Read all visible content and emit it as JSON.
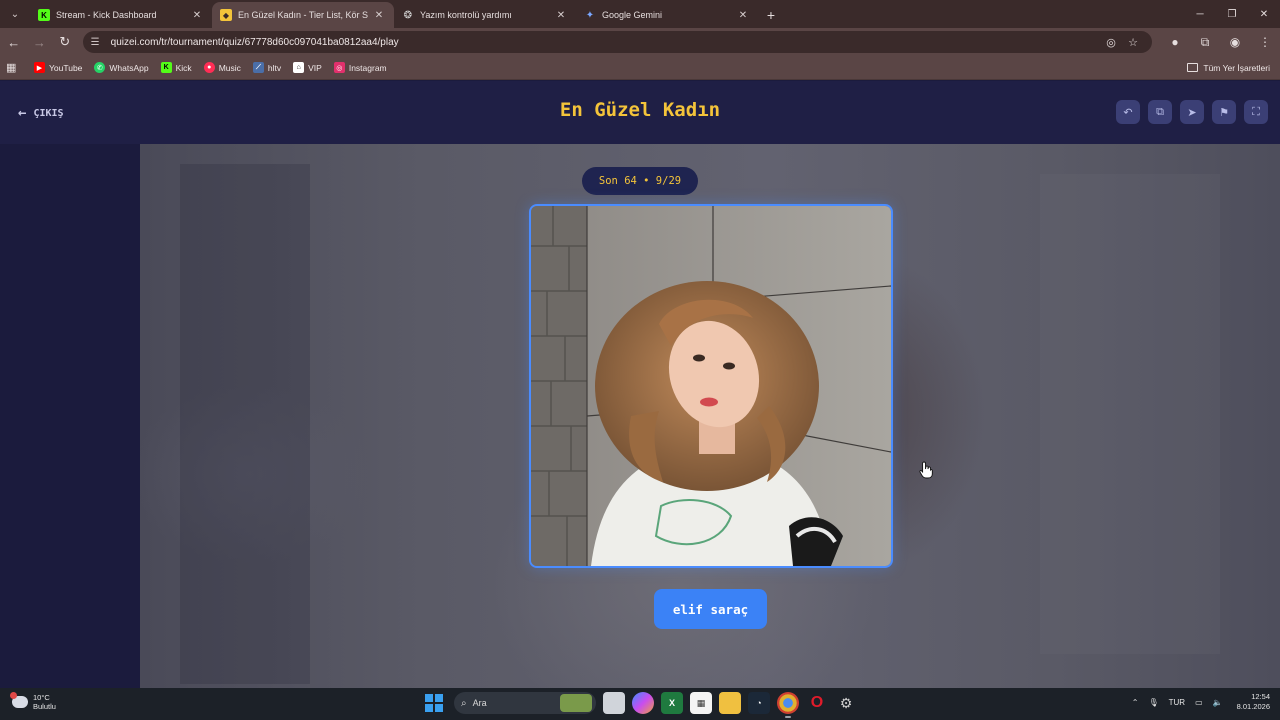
{
  "browser": {
    "tabs": [
      {
        "title": "Stream - Kick Dashboard",
        "icon": "kick-icon",
        "color": "#53fc18",
        "active": false
      },
      {
        "title": "En Güzel Kadın - Tier List, Kör S",
        "icon": "quizzei-icon",
        "color": "#f4c43a",
        "active": true
      },
      {
        "title": "Yazım kontrolü yardımı",
        "icon": "chatgpt-icon",
        "color": "#d8d8d8",
        "active": false
      },
      {
        "title": "Google Gemini",
        "icon": "gemini-icon",
        "color": "#7aa7ff",
        "active": false
      }
    ],
    "url": "quizei.com/tr/tournament/quiz/67778d60c097041ba0812aa4/play",
    "bookmarks": [
      {
        "label": "YouTube",
        "icon": "youtube-icon",
        "color": "#ff0000"
      },
      {
        "label": "WhatsApp",
        "icon": "whatsapp-icon",
        "color": "#25d366"
      },
      {
        "label": "Kick",
        "icon": "kick-icon",
        "color": "#53fc18"
      },
      {
        "label": "Music",
        "icon": "music-icon",
        "color": "#ff2d55"
      },
      {
        "label": "hltv",
        "icon": "hltv-icon",
        "color": "#4a6ea8"
      },
      {
        "label": "VIP",
        "icon": "vip-icon",
        "color": "#ffffff"
      },
      {
        "label": "Instagram",
        "icon": "instagram-icon",
        "color": "#e1306c"
      }
    ],
    "bookmarks_folder": "Tüm Yer İşaretleri"
  },
  "page": {
    "exit_label": "ÇIKIŞ",
    "title": "En Güzel Kadın",
    "round_label": "Son 64 • 9/29",
    "candidate_name": "elif saraç",
    "accent_color": "#f4c43a",
    "button_color": "#3b82f6",
    "header_actions": [
      "undo-icon",
      "share-icon",
      "send-icon",
      "flag-icon",
      "fullscreen-icon"
    ]
  },
  "taskbar": {
    "weather_temp": "10°C",
    "weather_desc": "Bulutlu",
    "search_placeholder": "Ara",
    "language": "TUR",
    "time": "12:54",
    "date": "8.01.2026"
  }
}
